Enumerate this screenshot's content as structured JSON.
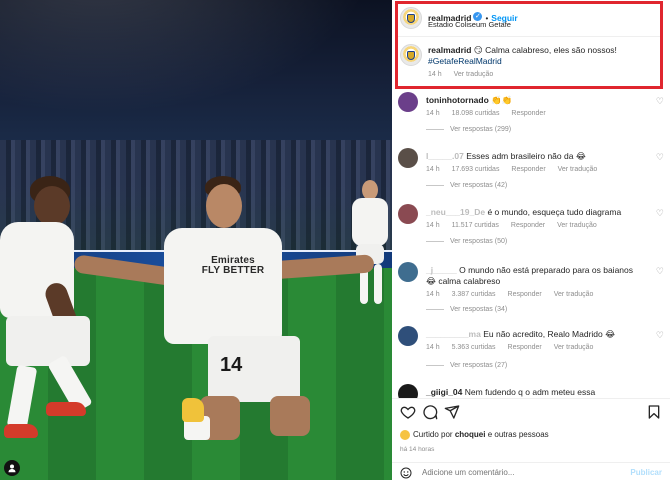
{
  "post": {
    "author": "realmadrid",
    "follow_label": "Seguir",
    "location": "Estadio Coliseum Getafe",
    "caption_user": "realmadrid",
    "caption_text": "Calma calabreso, eles são nossos!",
    "hashtag": "#GetafeRealMadrid",
    "caption_time": "14 h",
    "see_translation": "Ver tradução"
  },
  "photo": {
    "jersey_number": "14",
    "sponsor": "Emirates\nFLY BETTER"
  },
  "comments": [
    {
      "user": "toninhotornado",
      "text": "",
      "time": "14 h",
      "likes": "18.098 curtidas",
      "reply": "Responder",
      "translate": "",
      "replies": "Ver respostas (299)",
      "avatar_color": "#6b3f8a"
    },
    {
      "user": "l_____.07",
      "text": "Esses adm brasileiro não da",
      "time": "14 h",
      "likes": "17.693 curtidas",
      "reply": "Responder",
      "translate": "Ver tradução",
      "replies": "Ver respostas (42)",
      "avatar_color": "#5a4f48"
    },
    {
      "user": "_neu___19_De",
      "text": "é o mundo, esqueça tudo diagrama",
      "time": "14 h",
      "likes": "11.517 curtidas",
      "reply": "Responder",
      "translate": "Ver tradução",
      "replies": "Ver respostas (50)",
      "avatar_color": "#8a4a52"
    },
    {
      "user": "_j_____",
      "text": "O mundo não está preparado para os baianos",
      "time": "14 h",
      "likes": "3.387 curtidas",
      "reply": "Responder",
      "translate": "Ver tradução",
      "replies": "Ver respostas (34)",
      "avatar_color": "#3f6d8f"
    },
    {
      "user": "_________ma",
      "text": "Eu não acredito, Realo Madrido",
      "time": "14 h",
      "likes": "5.363 curtidas",
      "reply": "Responder",
      "translate": "Ver tradução",
      "replies": "Ver respostas (27)",
      "avatar_color": "#2f4f7a"
    },
    {
      "user": "_giigi_04",
      "text": "Nem fudendo q o adm meteu essa",
      "time": "",
      "likes": "",
      "reply": "",
      "translate": "",
      "replies": "",
      "avatar_color": "#1a1a1a"
    }
  ],
  "sub_caption": "calma calabreso",
  "footer": {
    "liked_by_prefix": "Curtido por",
    "liked_by_user": "choquei",
    "liked_by_suffix": "e outras pessoas",
    "time_ago": "há 14 horas",
    "comment_placeholder": "Adicione um comentário...",
    "publish_label": "Publicar"
  }
}
